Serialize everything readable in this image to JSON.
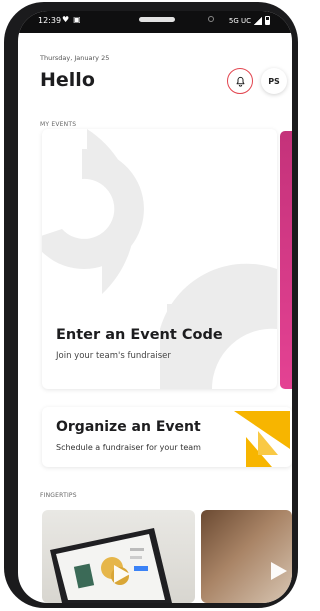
{
  "status_bar": {
    "time": "12:39",
    "network": "5G UC"
  },
  "header": {
    "date": "Thursday, January 25",
    "greeting": "Hello",
    "avatar_initials": "PS"
  },
  "sections": {
    "my_events": "MY EVENTS",
    "fingertips": "FINGERTIPS"
  },
  "event_code_card": {
    "title": "Enter an Event Code",
    "subtitle": "Join your team's fundraiser"
  },
  "organize_card": {
    "title": "Organize an Event",
    "subtitle": "Schedule a fundraiser for your team"
  },
  "colors": {
    "accent_red": "#e2454f",
    "pink": "#e44293",
    "yellow": "#f7b500"
  },
  "icons": [
    "bell-icon",
    "play-icon"
  ]
}
